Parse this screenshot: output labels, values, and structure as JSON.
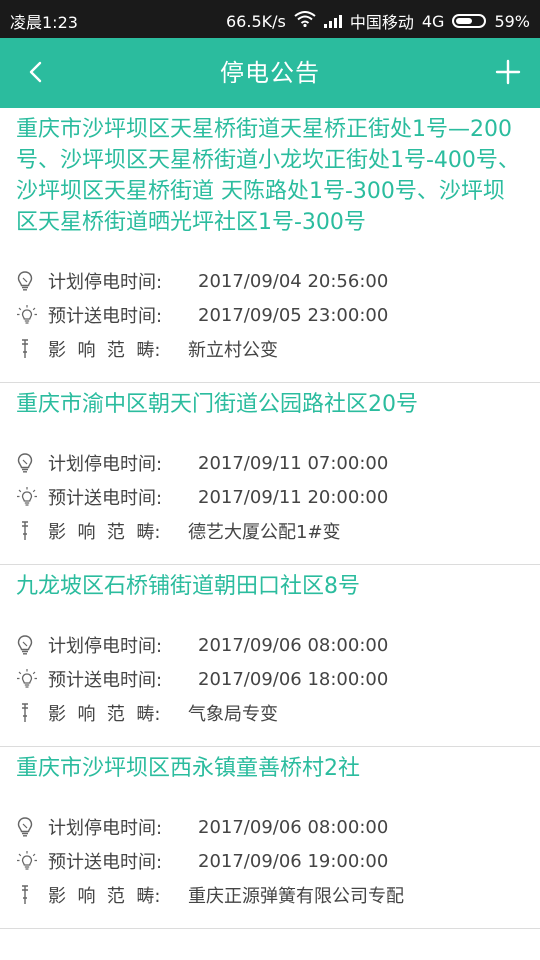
{
  "status_bar": {
    "time": "凌晨1:23",
    "speed": "66.5K/s",
    "carrier": "中国移动",
    "network": "4G",
    "battery": "59%",
    "battery_level": 0.59
  },
  "appbar": {
    "title": "停电公告",
    "back_icon": "chevron-left-icon",
    "add_icon": "plus-icon"
  },
  "labels": {
    "planned": "计划停电时间:",
    "restore": "预计送电时间:",
    "scope": "影  响  范  畴:"
  },
  "notices": [
    {
      "address": "重庆市沙坪坝区天星桥街道天星桥正街处1号—200号、沙坪坝区天星桥街道小龙坎正街处1号-400号、沙坪坝区天星桥街道 天陈路处1号-300号、沙坪坝区天星桥街道晒光坪社区1号-300号",
      "planned": "2017/09/04 20:56:00",
      "restore": "2017/09/05 23:00:00",
      "scope": "新立村公变"
    },
    {
      "address": "重庆市渝中区朝天门街道公园路社区20号",
      "planned": "2017/09/11 07:00:00",
      "restore": "2017/09/11 20:00:00",
      "scope": "德艺大厦公配1#变"
    },
    {
      "address": "九龙坡区石桥铺街道朝田口社区8号",
      "planned": "2017/09/06 08:00:00",
      "restore": "2017/09/06 18:00:00",
      "scope": "气象局专变"
    },
    {
      "address": "重庆市沙坪坝区西永镇童善桥村2社",
      "planned": "2017/09/06 08:00:00",
      "restore": "2017/09/06 19:00:00",
      "scope": "重庆正源弹簧有限公司专配"
    }
  ],
  "colors": {
    "accent": "#2bbc9e",
    "status_bar": "#1a1a1a",
    "text": "#444444"
  }
}
